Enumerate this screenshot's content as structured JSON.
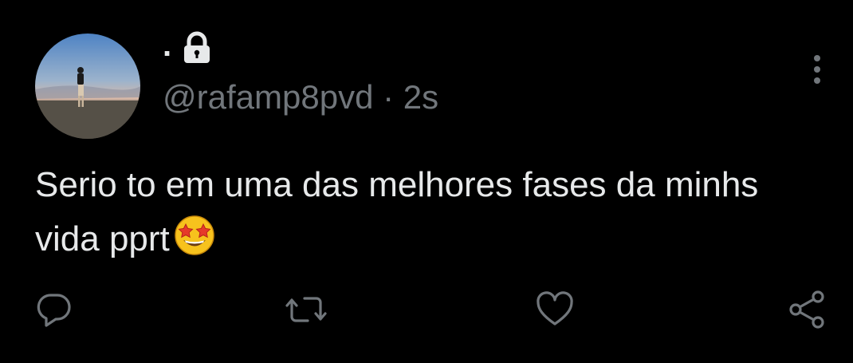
{
  "tweet": {
    "display_name": ".",
    "handle": "@rafamp8pvd",
    "separator": "·",
    "timestamp": "2s",
    "text": "Serio to em uma das melhores fases da minhs vida pprt",
    "emoji": "star-struck-emoji"
  },
  "icons": {
    "lock": "lock-icon",
    "more": "more-vertical-icon",
    "reply": "reply-icon",
    "retweet": "retweet-icon",
    "like": "heart-icon",
    "share": "share-icon"
  },
  "colors": {
    "background": "#000000",
    "primary_text": "#e7e9ea",
    "secondary_text": "#71767b"
  }
}
